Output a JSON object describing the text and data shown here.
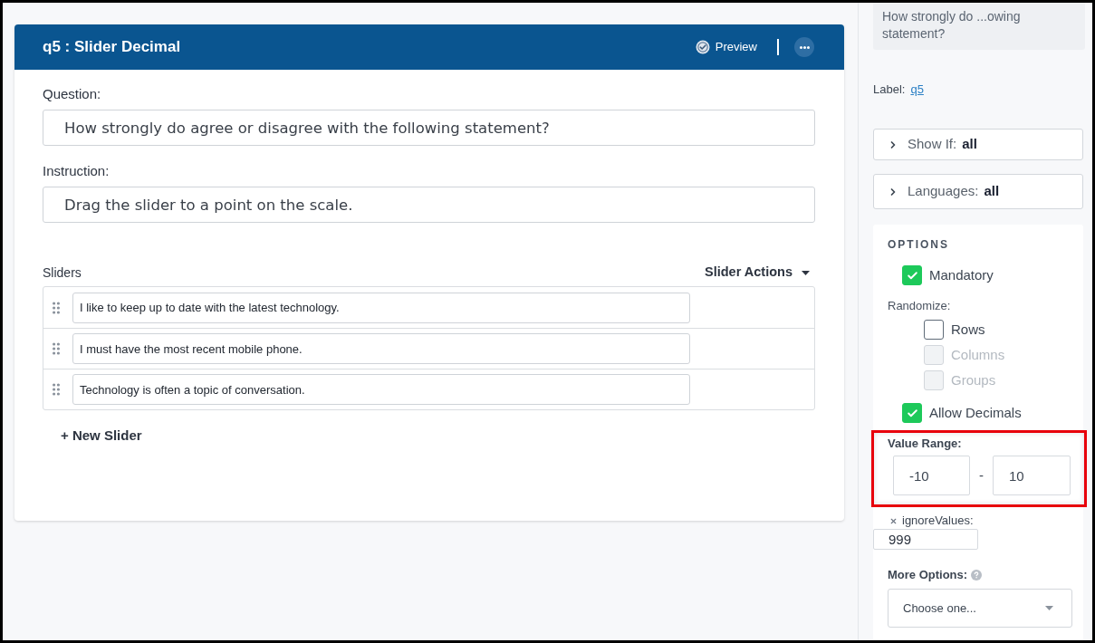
{
  "question_card": {
    "title": "q5 : Slider Decimal",
    "preview": "Preview",
    "question": {
      "label": "Question:",
      "value": "How strongly do agree or disagree with the following statement?"
    },
    "instruction": {
      "label": "Instruction:",
      "value": "Drag the slider to a point on the scale."
    },
    "sliders": {
      "label": "Sliders",
      "actions": "Slider Actions",
      "rows": [
        {
          "text": "I like to keep up to date with the latest technology."
        },
        {
          "text": "I must have the most recent mobile phone."
        },
        {
          "text": "Technology is often a topic of conversation."
        }
      ],
      "add_button": "+ New Slider"
    }
  },
  "sidebar": {
    "question_summary": "How strongly do ...owing statement?",
    "label": {
      "caption": "Label:",
      "value": "q5"
    },
    "sections": [
      {
        "label": "Show If:",
        "value": "all",
        "expanded": false
      },
      {
        "label": "Languages:",
        "value": "all",
        "expanded": false
      }
    ],
    "options": {
      "heading": "OPTIONS",
      "mandatory": {
        "label": "Mandatory",
        "checked": true
      },
      "randomize": {
        "label": "Randomize:",
        "items": [
          {
            "label": "Rows",
            "checked": false,
            "disabled": false
          },
          {
            "label": "Columns",
            "checked": false,
            "disabled": true
          },
          {
            "label": "Groups",
            "checked": false,
            "disabled": true
          }
        ]
      },
      "allow_decimals": {
        "label": "Allow Decimals",
        "checked": true
      },
      "value_range": {
        "label": "Value Range:",
        "min": "-10",
        "separator": "-",
        "max": "10",
        "highlighted": true
      },
      "ignore_values": {
        "label": "ignoreValues:",
        "value": "999"
      },
      "more_options": {
        "label": "More Options:",
        "placeholder": "Choose one..."
      }
    }
  }
}
